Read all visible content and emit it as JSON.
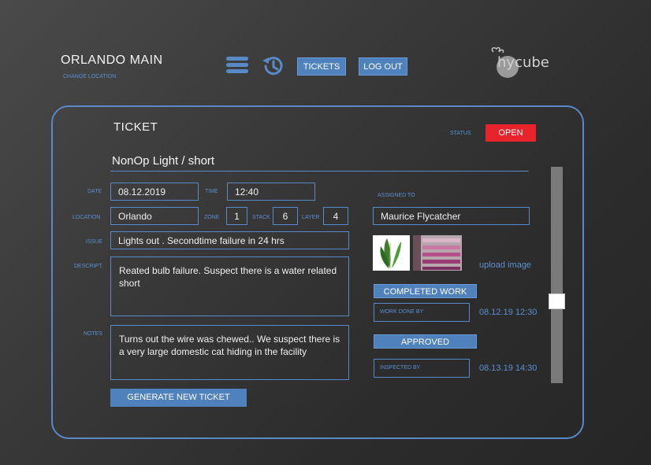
{
  "header": {
    "location_title": "ORLANDO MAIN",
    "change_location": "CHANGE LOCATION",
    "tickets_label": "TICKETS",
    "logout_label": "LOG OUT",
    "logo_text": "hycube"
  },
  "ticket": {
    "heading": "TICKET",
    "status_label": "STATUS",
    "status_value": "OPEN",
    "title": "NonOp Light / short",
    "labels": {
      "date": "DATE",
      "time": "TIME",
      "location": "LOCATION",
      "zone": "ZONE",
      "stack": "STACK",
      "layer": "LAYER",
      "issue": "ISSUE",
      "descript": "DESCRIPT.",
      "notes": "NOTES",
      "assigned_to": "ASSIGNED TO"
    },
    "date": "08.12.2019",
    "time": "12:40",
    "location": "Orlando",
    "zone": "1",
    "stack": "6",
    "layer": "4",
    "issue": "Lights out . Secondtime failure in 24 hrs",
    "description": "Reated bulb failure. Suspect there is a water related short",
    "notes": "Turns out the wire was chewed.. We suspect there is a very large domestic cat hiding in the facility",
    "assigned_to": "Maurice Flycatcher",
    "generate_label": "GENERATE NEW TICKET"
  },
  "workflow": {
    "upload_label": "upload image",
    "completed_label": "COMPLETED WORK",
    "work_done_by": "WORK DONE BY",
    "work_done_stamp": "08.12.19   12:30",
    "approved_label": "APPROVED",
    "inspected_by": "INSPECTED BY",
    "inspected_stamp": "08.13.19   14:30"
  },
  "colors": {
    "accent": "#4f81bd",
    "status_open": "#e8232c",
    "label_blue": "#5b8fd0"
  },
  "icons": [
    "menu-icon",
    "history-icon",
    "hycube-logo"
  ]
}
